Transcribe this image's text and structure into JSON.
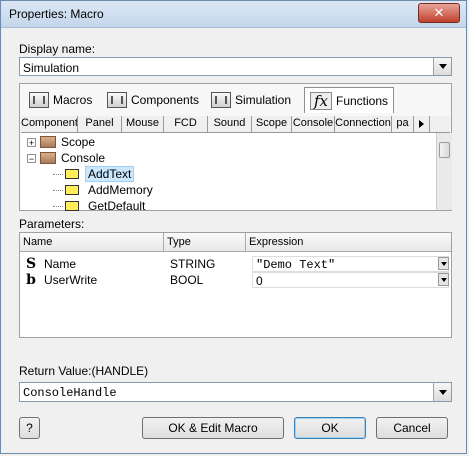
{
  "window": {
    "title": "Properties: Macro",
    "close_label": "✕"
  },
  "display_name": {
    "label": "Display name:",
    "value": "Simulation"
  },
  "tabs": [
    {
      "label": "Macros",
      "icon": "component-icon"
    },
    {
      "label": "Components",
      "icon": "component-icon"
    },
    {
      "label": "Simulation",
      "icon": "component-icon"
    },
    {
      "label": "Functions",
      "icon": "fx-icon",
      "active": true
    }
  ],
  "sub_tabs": [
    "Component",
    "Panel",
    "Mouse",
    "FCD",
    "Sound",
    "Scope",
    "Console",
    "Connection",
    "pa"
  ],
  "tree": [
    {
      "label": "Scope",
      "type": "folder",
      "expander": "+"
    },
    {
      "label": "Console",
      "type": "folder",
      "expander": "−"
    },
    {
      "label": "AddText",
      "type": "function",
      "selected": true
    },
    {
      "label": "AddMemory",
      "type": "function"
    },
    {
      "label": "GetDefault",
      "type": "function"
    }
  ],
  "parameters": {
    "label": "Parameters:",
    "columns": [
      "Name",
      "Type",
      "Expression"
    ],
    "rows": [
      {
        "icon": "S",
        "name": "Name",
        "type": "STRING",
        "expression": "\"Demo Text\""
      },
      {
        "icon": "b",
        "name": "UserWrite",
        "type": "BOOL",
        "expression": "0"
      }
    ]
  },
  "return_value": {
    "label": "Return Value:(HANDLE)",
    "value": "ConsoleHandle"
  },
  "buttons": {
    "help": "?",
    "ok_edit": "OK & Edit Macro",
    "ok": "OK",
    "cancel": "Cancel"
  }
}
